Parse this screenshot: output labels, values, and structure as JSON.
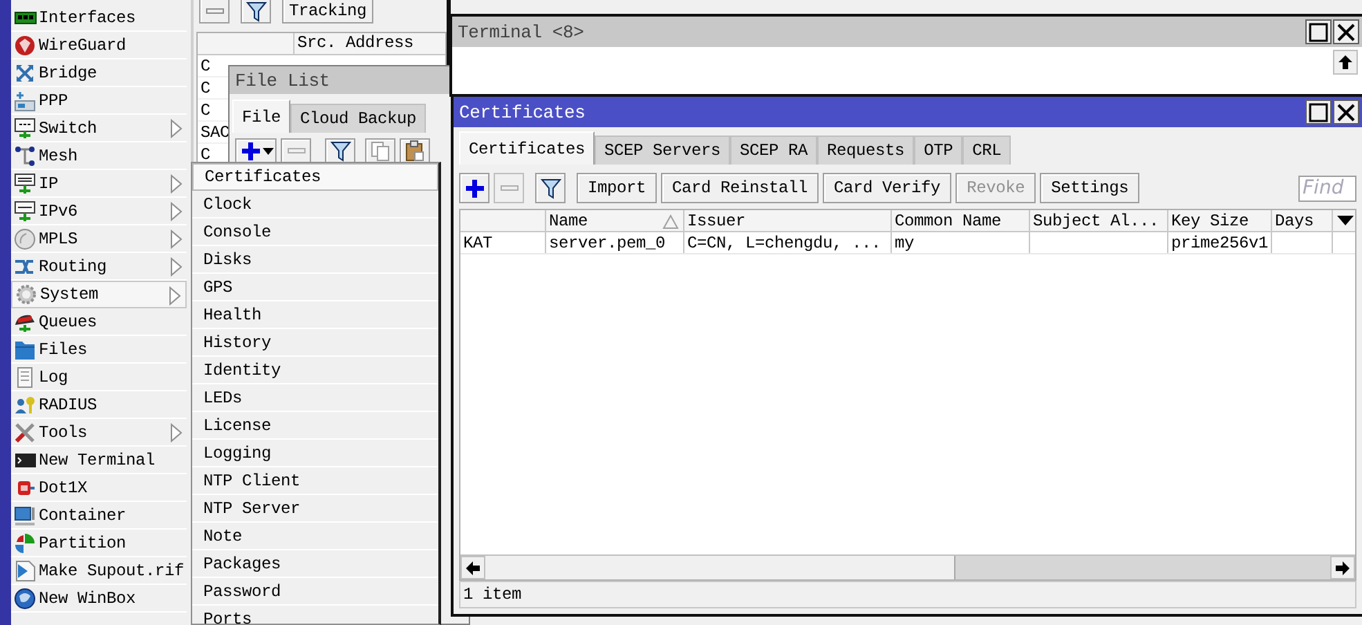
{
  "desktop_menu": {
    "items": [
      {
        "label": "Interfaces",
        "submenu": false,
        "selected": false
      },
      {
        "label": "WireGuard",
        "submenu": false,
        "selected": false
      },
      {
        "label": "Bridge",
        "submenu": false,
        "selected": false
      },
      {
        "label": "PPP",
        "submenu": false,
        "selected": false
      },
      {
        "label": "Switch",
        "submenu": true,
        "selected": false
      },
      {
        "label": "Mesh",
        "submenu": false,
        "selected": false
      },
      {
        "label": "IP",
        "submenu": true,
        "selected": false
      },
      {
        "label": "IPv6",
        "submenu": true,
        "selected": false
      },
      {
        "label": "MPLS",
        "submenu": true,
        "selected": false
      },
      {
        "label": "Routing",
        "submenu": true,
        "selected": false
      },
      {
        "label": "System",
        "submenu": true,
        "selected": true
      },
      {
        "label": "Queues",
        "submenu": false,
        "selected": false
      },
      {
        "label": "Files",
        "submenu": false,
        "selected": false
      },
      {
        "label": "Log",
        "submenu": false,
        "selected": false
      },
      {
        "label": "RADIUS",
        "submenu": false,
        "selected": false
      },
      {
        "label": "Tools",
        "submenu": true,
        "selected": false
      },
      {
        "label": "New Terminal",
        "submenu": false,
        "selected": false
      },
      {
        "label": "Dot1X",
        "submenu": false,
        "selected": false
      },
      {
        "label": "Container",
        "submenu": false,
        "selected": false
      },
      {
        "label": "Partition",
        "submenu": false,
        "selected": false
      },
      {
        "label": "Make Supout.rif",
        "submenu": false,
        "selected": false
      },
      {
        "label": "New WinBox",
        "submenu": false,
        "selected": false
      }
    ]
  },
  "connections_window": {
    "tracking_button": "Tracking",
    "src_address_header": "Src. Address",
    "rows": [
      {
        "column_1": "C"
      },
      {
        "column_1": "C"
      },
      {
        "column_1": "C"
      },
      {
        "column_1": "SAC"
      },
      {
        "column_1": "C"
      }
    ]
  },
  "file_list_window": {
    "title": "File List",
    "tabs": [
      {
        "label": "File",
        "selected": true
      },
      {
        "label": "Cloud Backup",
        "selected": false
      }
    ]
  },
  "system_submenu": {
    "items": [
      {
        "label": "Certificates",
        "selected": true
      },
      {
        "label": "Clock",
        "selected": false
      },
      {
        "label": "Console",
        "selected": false
      },
      {
        "label": "Disks",
        "selected": false
      },
      {
        "label": "GPS",
        "selected": false
      },
      {
        "label": "Health",
        "selected": false
      },
      {
        "label": "History",
        "selected": false
      },
      {
        "label": "Identity",
        "selected": false
      },
      {
        "label": "LEDs",
        "selected": false
      },
      {
        "label": "License",
        "selected": false
      },
      {
        "label": "Logging",
        "selected": false
      },
      {
        "label": "NTP Client",
        "selected": false
      },
      {
        "label": "NTP Server",
        "selected": false
      },
      {
        "label": "Note",
        "selected": false
      },
      {
        "label": "Packages",
        "selected": false
      },
      {
        "label": "Password",
        "selected": false
      },
      {
        "label": "Ports",
        "selected": false
      }
    ]
  },
  "terminal_window": {
    "title": "Terminal <8>",
    "active": false
  },
  "certificates_window": {
    "title": "Certificates",
    "active": true,
    "tabs": [
      {
        "label": "Certificates",
        "selected": true
      },
      {
        "label": "SCEP Servers",
        "selected": false
      },
      {
        "label": "SCEP RA",
        "selected": false
      },
      {
        "label": "Requests",
        "selected": false
      },
      {
        "label": "OTP",
        "selected": false
      },
      {
        "label": "CRL",
        "selected": false
      }
    ],
    "toolbar": [
      {
        "kind": "add",
        "disabled": false
      },
      {
        "kind": "remove",
        "disabled": true
      },
      {
        "kind": "filter",
        "disabled": false
      },
      {
        "kind": "text",
        "label": "Import",
        "disabled": false
      },
      {
        "kind": "text",
        "label": "Card Reinstall",
        "disabled": false
      },
      {
        "kind": "text",
        "label": "Card Verify",
        "disabled": false
      },
      {
        "kind": "text",
        "label": "Revoke",
        "disabled": true
      },
      {
        "kind": "text",
        "label": "Settings",
        "disabled": false
      }
    ],
    "find": {
      "placeholder": "Find"
    },
    "columns": [
      {
        "label": "Name",
        "sorted": true
      },
      {
        "label": "Issuer",
        "sorted": false
      },
      {
        "label": "Common Name",
        "sorted": false
      },
      {
        "label": "Subject Al...",
        "sorted": false
      },
      {
        "label": "Key Size",
        "sorted": false
      },
      {
        "label": "Days",
        "sorted": false
      }
    ],
    "rows": [
      {
        "column_1": "KAT",
        "name": "server.pem_0",
        "issuer": "C=CN, L=chengdu, ...",
        "common_name": "my",
        "key_size": "prime256v1"
      }
    ],
    "status": "1 item"
  }
}
